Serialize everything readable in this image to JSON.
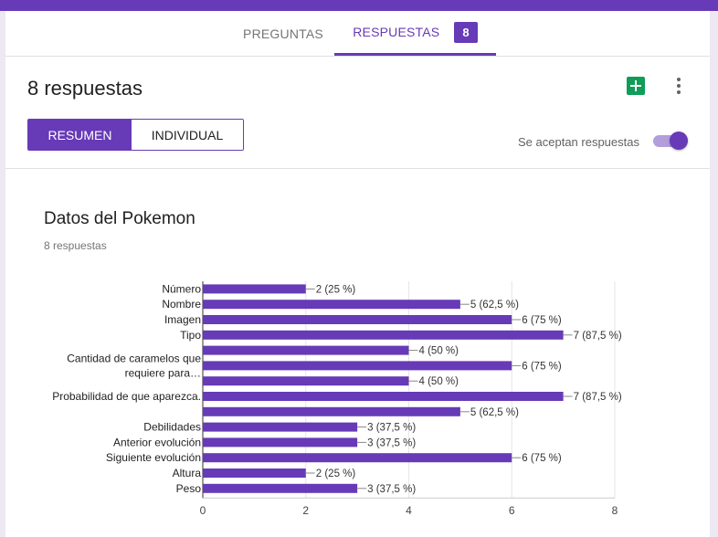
{
  "tabs": {
    "preguntas": "PREGUNTAS",
    "respuestas": "RESPUESTAS",
    "respuestas_badge": "8"
  },
  "header": {
    "title": "8 respuestas",
    "resumen": "RESUMEN",
    "individual": "INDIVIDUAL",
    "accepting_label": "Se aceptan respuestas",
    "accepting": true
  },
  "icons": [
    "sheets-icon",
    "more-vert-icon"
  ],
  "colors": {
    "accent": "#673ab7",
    "sheets": "#0f9d58"
  },
  "question": {
    "title": "Datos del Pokemon",
    "count": "8 respuestas"
  },
  "chart_data": {
    "type": "bar",
    "orientation": "horizontal",
    "categories": [
      [
        "Número"
      ],
      [
        "Nombre"
      ],
      [
        "Imagen"
      ],
      [
        "Tipo"
      ],
      [],
      [
        "Cantidad de caramelos que",
        "requiere para…"
      ],
      [],
      [
        "Probabilidad de que aparezca."
      ],
      [],
      [
        "Debilidades"
      ],
      [
        "Anterior evolución"
      ],
      [
        "Siguiente evolución"
      ],
      [
        "Altura"
      ],
      [
        "Peso"
      ]
    ],
    "values": [
      2,
      5,
      6,
      7,
      4,
      6,
      4,
      7,
      5,
      3,
      3,
      6,
      2,
      3
    ],
    "labels": [
      "2 (25 %)",
      "5 (62,5 %)",
      "6 (75 %)",
      "7 (87,5 %)",
      "4 (50 %)",
      "6 (75 %)",
      "4 (50 %)",
      "7 (87,5 %)",
      "5 (62,5 %)",
      "3 (37,5 %)",
      "3 (37,5 %)",
      "6 (75 %)",
      "2 (25 %)",
      "3 (37,5 %)"
    ],
    "xlim": [
      0,
      8
    ],
    "xticks": [
      0,
      2,
      4,
      6,
      8
    ],
    "grid": true,
    "color": "#673ab7"
  }
}
